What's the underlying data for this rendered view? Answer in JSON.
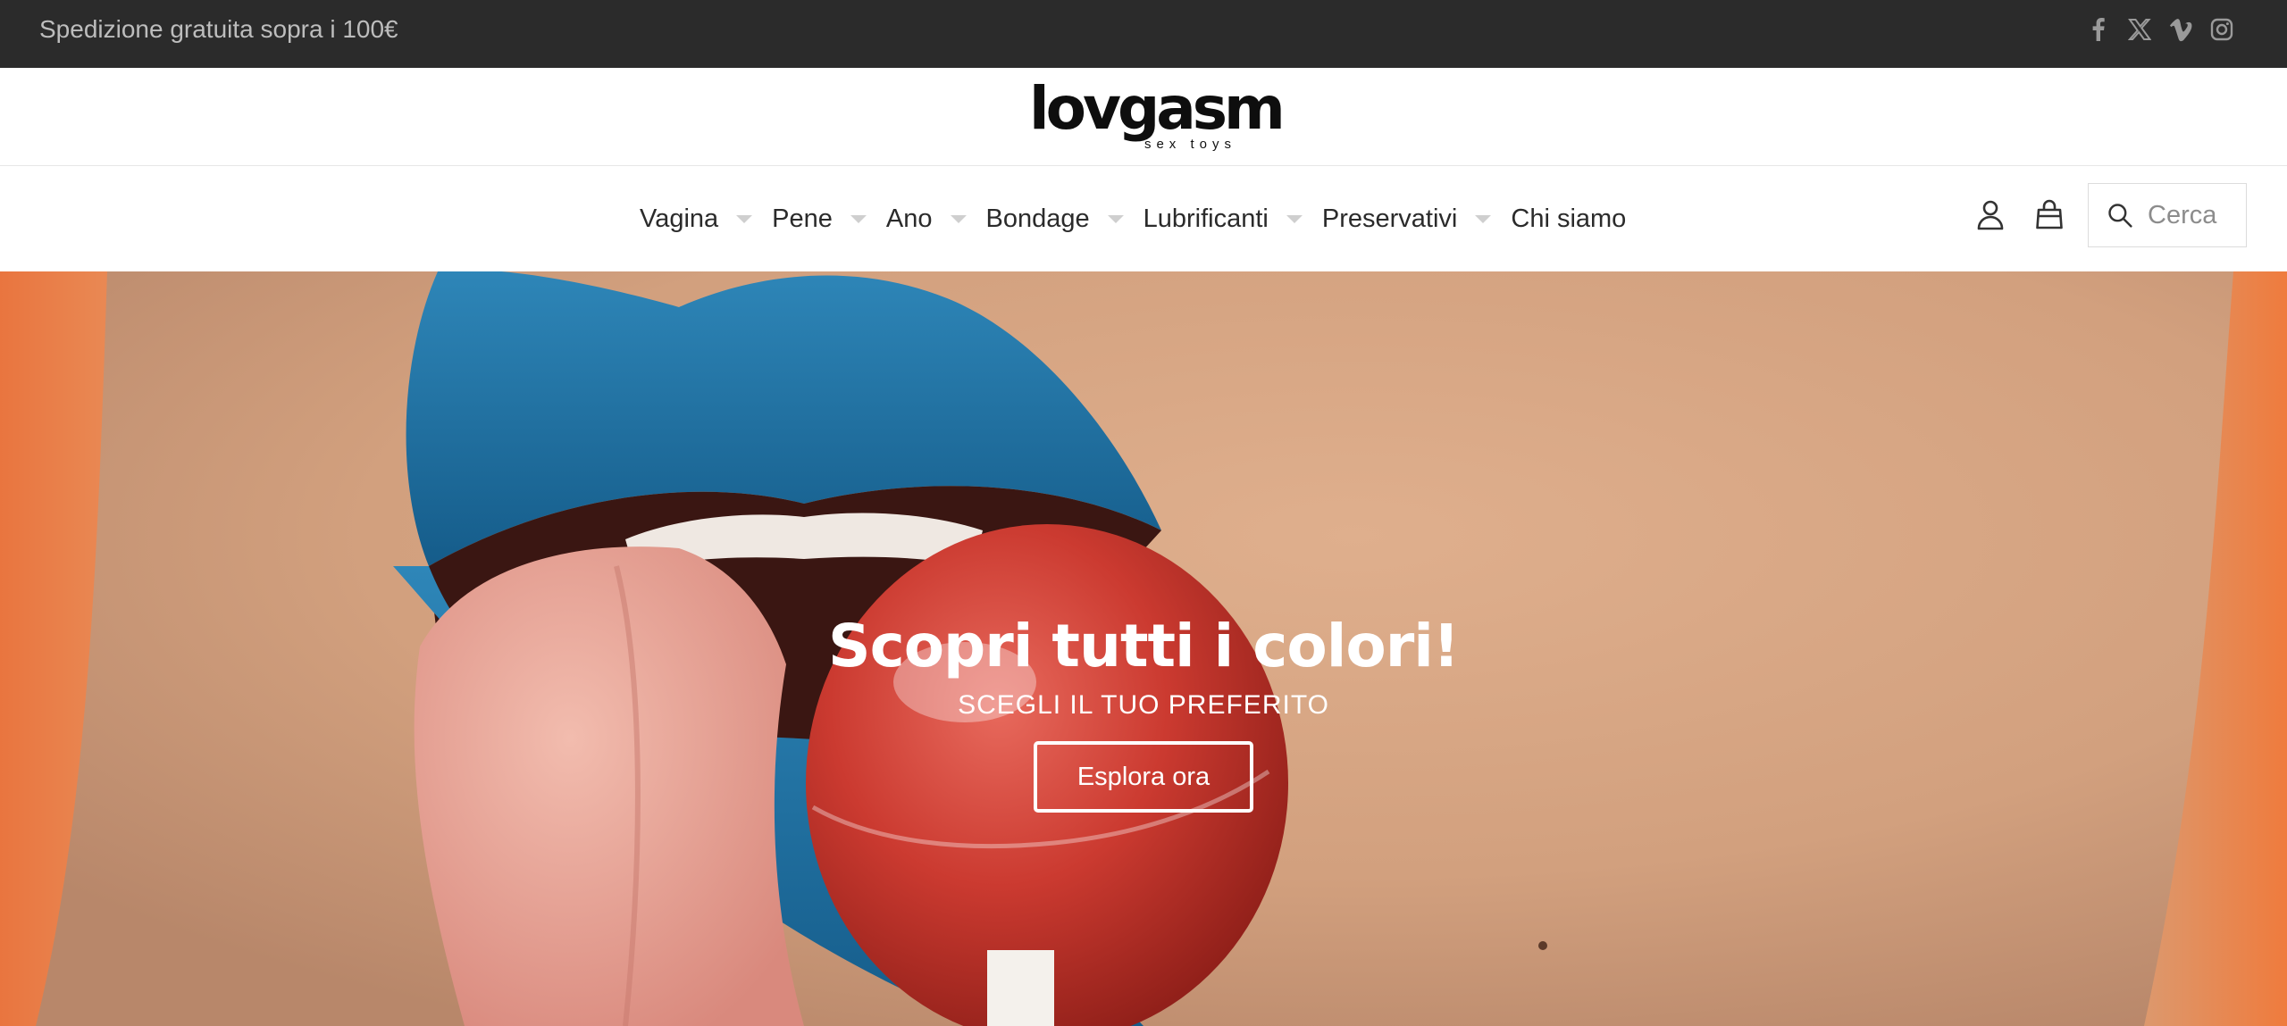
{
  "announcement": "Spedizione gratuita sopra i 100€",
  "social": [
    "facebook-icon",
    "x-icon",
    "vimeo-icon",
    "instagram-icon"
  ],
  "logo": {
    "word": "lovgasm",
    "tagline": "sex toys"
  },
  "nav": {
    "items": [
      {
        "label": "Vagina",
        "dropdown": true
      },
      {
        "label": "Pene",
        "dropdown": true
      },
      {
        "label": "Ano",
        "dropdown": true
      },
      {
        "label": "Bondage",
        "dropdown": true
      },
      {
        "label": "Lubrificanti",
        "dropdown": true
      },
      {
        "label": "Preservativi",
        "dropdown": true
      },
      {
        "label": "Chi siamo",
        "dropdown": false
      }
    ],
    "icons": [
      "account-icon",
      "cart-icon"
    ],
    "search": {
      "placeholder": "Cerca"
    }
  },
  "hero": {
    "title": "Scopri tutti i colori!",
    "subtitle": "SCEGLI IL TUO PREFERITO",
    "button": "Esplora ora"
  },
  "colors": {
    "topbar_bg": "#2b2b2b",
    "announcement_text": "#bdbdbd",
    "lip_blue": "#1d6a9e",
    "candy_red": "#c8322a",
    "background_orange": "#ef7b3d"
  }
}
